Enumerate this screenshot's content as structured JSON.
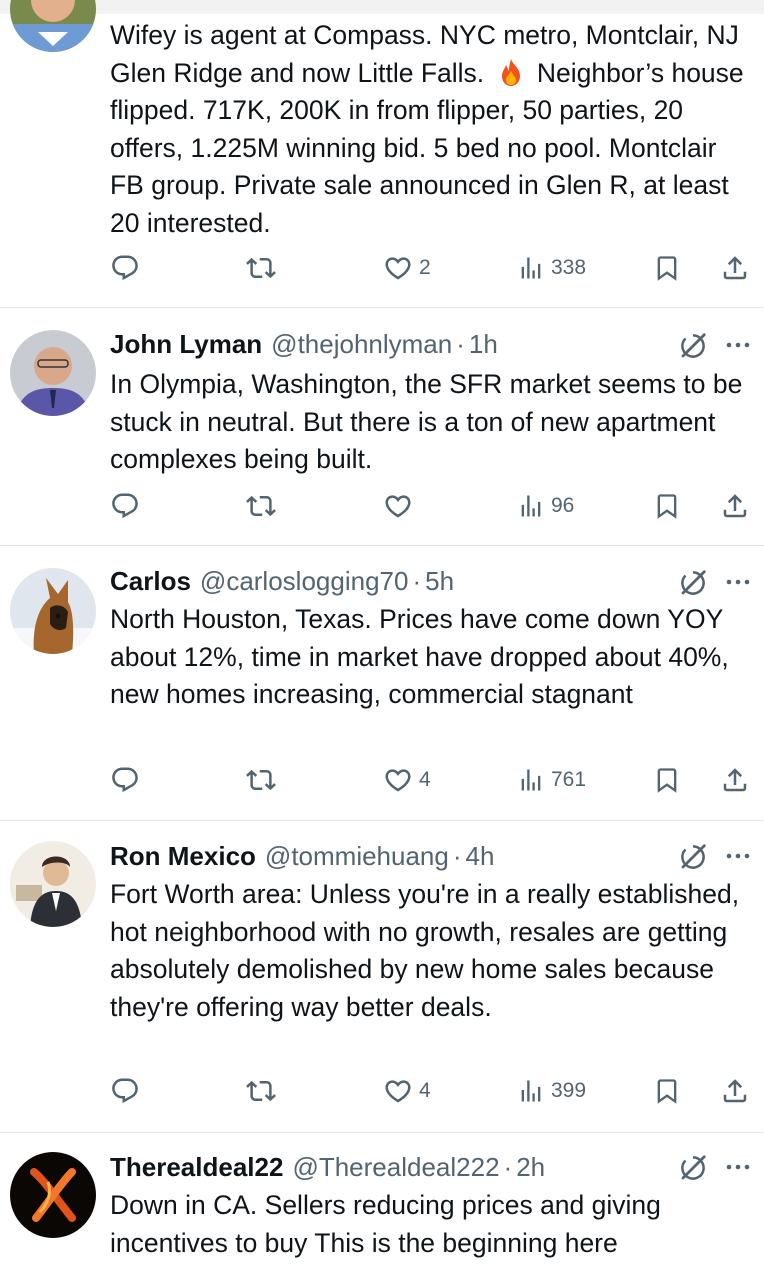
{
  "colors": {
    "text": "#0f1419",
    "muted": "#536471",
    "divider": "#e3e3e3"
  },
  "tweets": [
    {
      "avatar_icon": "avatar-icon",
      "text_before_emoji": "Wifey is agent at Compass. NYC metro, Montclair, NJ Glen Ridge and now Little Falls.",
      "emoji": "fire-icon",
      "text_after_emoji": "Neighbor’s house flipped. 717K, 200K in from flipper, 50 parties, 20 offers, 1.225M winning bid. 5 bed no pool. Montclair FB group. Private sale announced in Glen R, at least 20 interested.",
      "likes": "2",
      "views": "338"
    },
    {
      "name": "John Lyman",
      "handle": "@thejohnlyman",
      "separator": "·",
      "time": "1h",
      "text": "In Olympia, Washington, the SFR market seems to be stuck in neutral. But there is a ton of new apartment complexes being built.",
      "likes": "",
      "views": "96"
    },
    {
      "name": "Carlos",
      "handle": "@carloslogging70",
      "separator": "·",
      "time": "5h",
      "text": "North Houston,  Texas. Prices have come down YOY about 12%, time in market have dropped about 40%, new homes increasing, commercial stagnant",
      "likes": "4",
      "views": "761"
    },
    {
      "name": "Ron Mexico",
      "handle": "@tommiehuang",
      "separator": "·",
      "time": "4h",
      "text": "Fort Worth area: Unless you're in a really established, hot neighborhood with no growth, resales are getting absolutely demolished by new home sales because they're offering way better deals.",
      "likes": "4",
      "views": "399"
    },
    {
      "name": "Therealdeal22",
      "handle": "@Therealdeal222",
      "separator": "·",
      "time": "2h",
      "text": "Down in CA. Sellers reducing prices and giving incentives to buy   This is the beginning here"
    }
  ]
}
